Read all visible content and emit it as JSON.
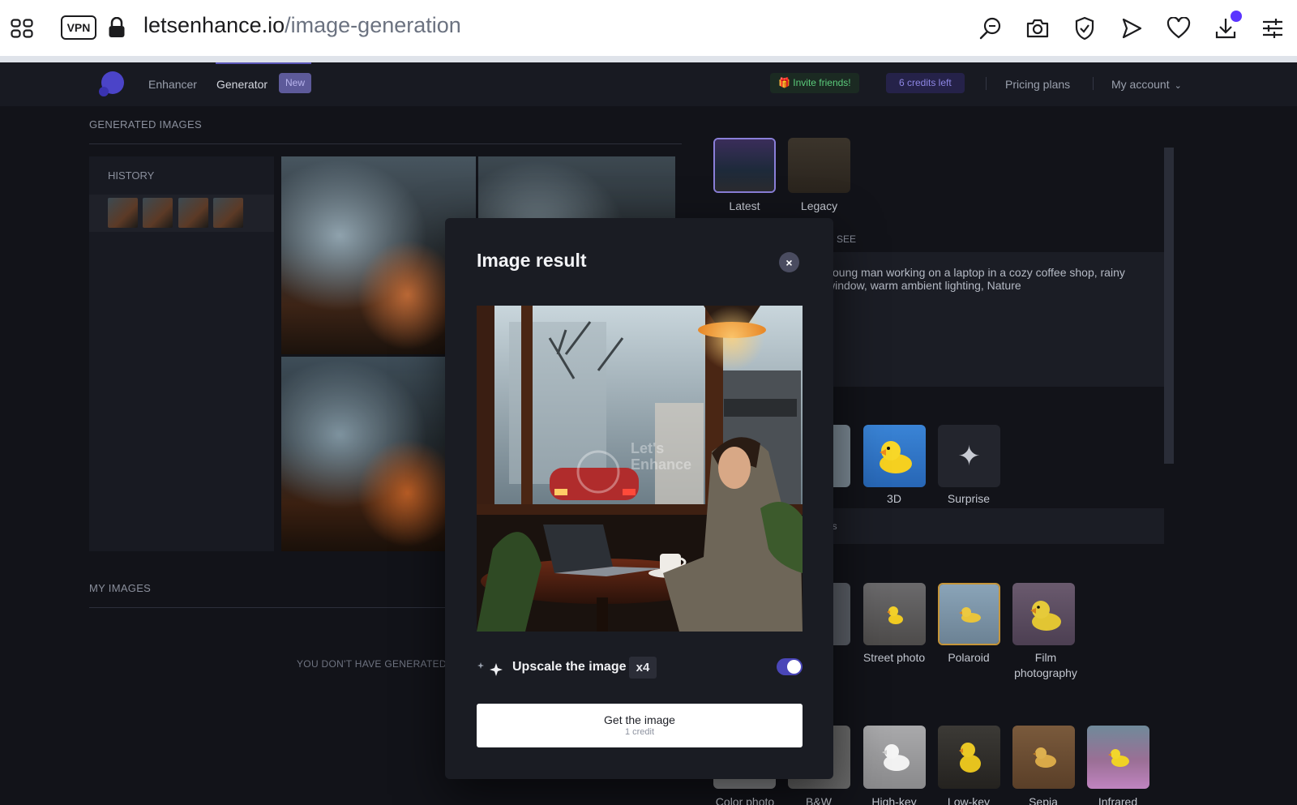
{
  "browser": {
    "vpn_label": "VPN",
    "url_domain": "letsenhance.io",
    "url_path": "/image-generation",
    "icons": [
      "search-icon",
      "camera-icon",
      "shield-check-icon",
      "send-icon",
      "heart-icon",
      "download-icon",
      "settings-sliders-icon"
    ]
  },
  "nav": {
    "links": [
      "Enhancer",
      "Generator"
    ],
    "new_badge": "New",
    "invite": "🎁 Invite friends!",
    "credits": "6 credits left",
    "pricing": "Pricing plans",
    "account": "My account"
  },
  "generated": {
    "title": "GENERATED IMAGES",
    "history_label": "HISTORY"
  },
  "my_images": {
    "title": "MY IMAGES",
    "empty_text": "YOU DON'T HAVE GENERATED IM"
  },
  "right": {
    "models": [
      "Latest",
      "Legacy"
    ],
    "section_fragment": "D SEE",
    "prompt": "young man working on a laptop in a cozy coffee shop, rainy window, warm ambient lighting, Nature",
    "style_row1": [
      "on",
      "3D",
      "Surprise"
    ],
    "fragment_ns": "ns",
    "style_row2_fragment": "ct",
    "style_row2": [
      "Street photo",
      "Polaroid",
      "Film photography"
    ],
    "style_row3": [
      "Color photo",
      "B&W",
      "High-key",
      "Low-key",
      "Sepia",
      "Infrared"
    ]
  },
  "modal": {
    "title": "Image result",
    "close": "×",
    "upscale_label": "Upscale the image",
    "upscale_factor": "x4",
    "upscale_enabled": true,
    "button_label": "Get the image",
    "button_sub": "1 credit"
  },
  "colors": {
    "accent": "#5b35ff",
    "toggle_on": "#4a46b8",
    "background": "#121319"
  }
}
